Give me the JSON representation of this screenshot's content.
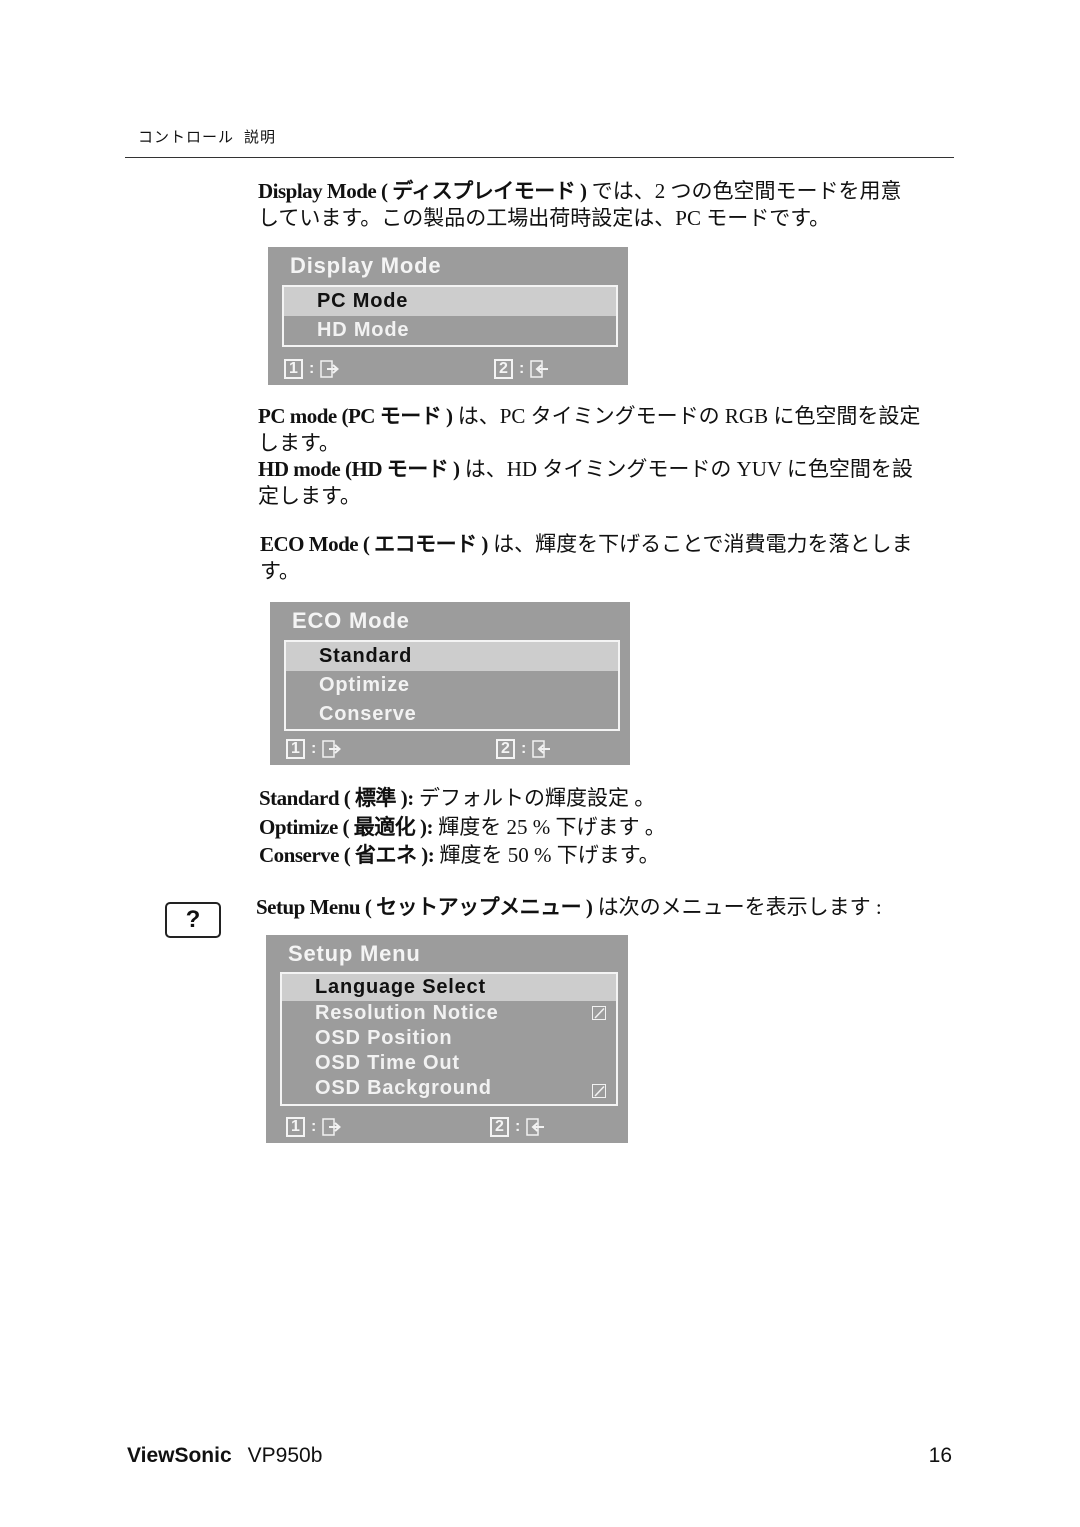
{
  "header": {
    "section": "コントロール",
    "subsection": "説明"
  },
  "display_mode": {
    "intro_bold": "Display Mode ( ディスプレイモード )",
    "intro_line1": " では、2 つの色空間モードを用意",
    "intro_line2": "しています。この製品の工場出荷時設定は、PC モードです。",
    "osd": {
      "title": "Display Mode",
      "items": [
        {
          "label": "PC Mode",
          "selected": true
        },
        {
          "label": "HD Mode",
          "selected": false
        }
      ],
      "key1": "1",
      "key2": "2"
    },
    "pc_bold": "PC mode (PC モード )",
    "pc_line1": " は、PC タイミングモードの RGB に色空間を設定",
    "pc_line2": "します。",
    "hd_bold": "HD mode (HD モード )",
    "hd_line1": " は、HD タイミングモードの YUV に色空間を設",
    "hd_line2": "定します。"
  },
  "eco_mode": {
    "intro_bold": "ECO Mode ( エコモード )",
    "intro_line1": " は、輝度を下げることで消費電力を落としま",
    "intro_line2": "す。",
    "osd": {
      "title": "ECO Mode",
      "items": [
        {
          "label": "Standard",
          "selected": true
        },
        {
          "label": "Optimize",
          "selected": false
        },
        {
          "label": "Conserve",
          "selected": false
        }
      ],
      "key1": "1",
      "key2": "2"
    },
    "descriptions": [
      {
        "bold": "Standard ( 標準 ):",
        "text": " デフォルトの輝度設定 。"
      },
      {
        "bold": "Optimize ( 最適化 ):",
        "text": " 輝度を 25 % 下げます 。"
      },
      {
        "bold": "Conserve ( 省エネ ):",
        "text": " 輝度を 50 % 下げます。"
      }
    ]
  },
  "setup_menu": {
    "help_icon_glyph": "?",
    "intro_bold": "Setup Menu ( セットアップメニュー )",
    "intro_text": " は次のメニューを表示します :",
    "osd": {
      "title": "Setup Menu",
      "items": [
        {
          "label": "Language Select",
          "selected": true,
          "checkbox": false
        },
        {
          "label": "Resolution Notice",
          "selected": false,
          "checkbox": true
        },
        {
          "label": "OSD Position",
          "selected": false,
          "checkbox": false
        },
        {
          "label": "OSD Time Out",
          "selected": false,
          "checkbox": false
        },
        {
          "label": "OSD Background",
          "selected": false,
          "checkbox": true
        }
      ],
      "key1": "1",
      "key2": "2"
    }
  },
  "footer": {
    "brand": "ViewSonic",
    "model": "VP950b",
    "page_number": "16"
  },
  "colors": {
    "osd_background": "#9c9c9c",
    "osd_selected": "#cdcdcd",
    "osd_text": "#f2f2f2"
  }
}
